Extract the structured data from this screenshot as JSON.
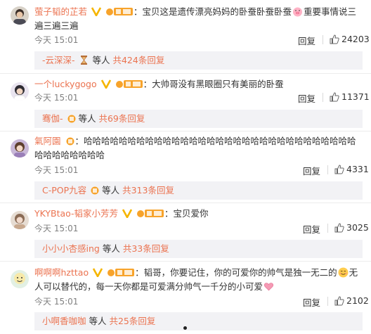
{
  "comments": [
    {
      "user": "萤子韬的芷若",
      "text_a": "宝贝这是遗传漂亮妈妈的卧蚕卧蚕卧蚕",
      "text_b": "重要事情说三遍三遍三遍",
      "time": "今天 15:01",
      "reply_label": "回复",
      "likes": "24203",
      "replies": {
        "name": "-云深深-",
        "mid": " 等人 ",
        "count": "共424条回复"
      }
    },
    {
      "user": "一个luckygogo",
      "text": "大帅哥没有黑眼圈只有美丽的卧蚕",
      "time": "今天 15:01",
      "reply_label": "回复",
      "likes": "11371",
      "replies": {
        "name": "骞伽-",
        "mid": " 等人 ",
        "count": "共69条回复"
      }
    },
    {
      "user": "氣阿園",
      "text": "哈哈哈哈哈哈哈哈哈哈哈哈哈哈哈哈哈哈哈哈哈哈哈哈哈哈哈哈哈哈哈哈哈哈哈哈哈哈哈",
      "time": "今天 15:01",
      "reply_label": "回复",
      "likes": "4331",
      "replies": {
        "name": "C-POP九容",
        "mid": " 等人 ",
        "count": "共313条回复"
      }
    },
    {
      "user": "YKYBtao-韬家小芳芳",
      "text": "宝贝爱你",
      "time": "今天 15:01",
      "reply_label": "回复",
      "likes": "3025",
      "replies": {
        "name": "小小小杏感ing",
        "mid": " 等人 ",
        "count": "共33条回复"
      }
    },
    {
      "user": "啊啊啊hzttao",
      "text_a": "韬哥，你要记住，你的可爱你的帅气是独一无二的",
      "text_b": "无人可以替代的，每一天你都是可爱满分帅气一千分的小可爱",
      "time": "今天 15:01",
      "reply_label": "回复",
      "likes": "2102",
      "replies": {
        "name": "小啊香咖咖",
        "mid": " 等人 ",
        "count": "共25条回复"
      }
    }
  ],
  "colors": {
    "username": "#eb7350",
    "reply_bar": "#f2f2f5",
    "fan_badge": "#f7a32b",
    "vip": "#f5b500"
  },
  "icons": [
    "verified-v-icon",
    "fan-badge-icon",
    "thumbs-up-icon",
    "pig-emoji",
    "smile-emoji",
    "heart-emoji",
    "hourglass-emoji"
  ]
}
